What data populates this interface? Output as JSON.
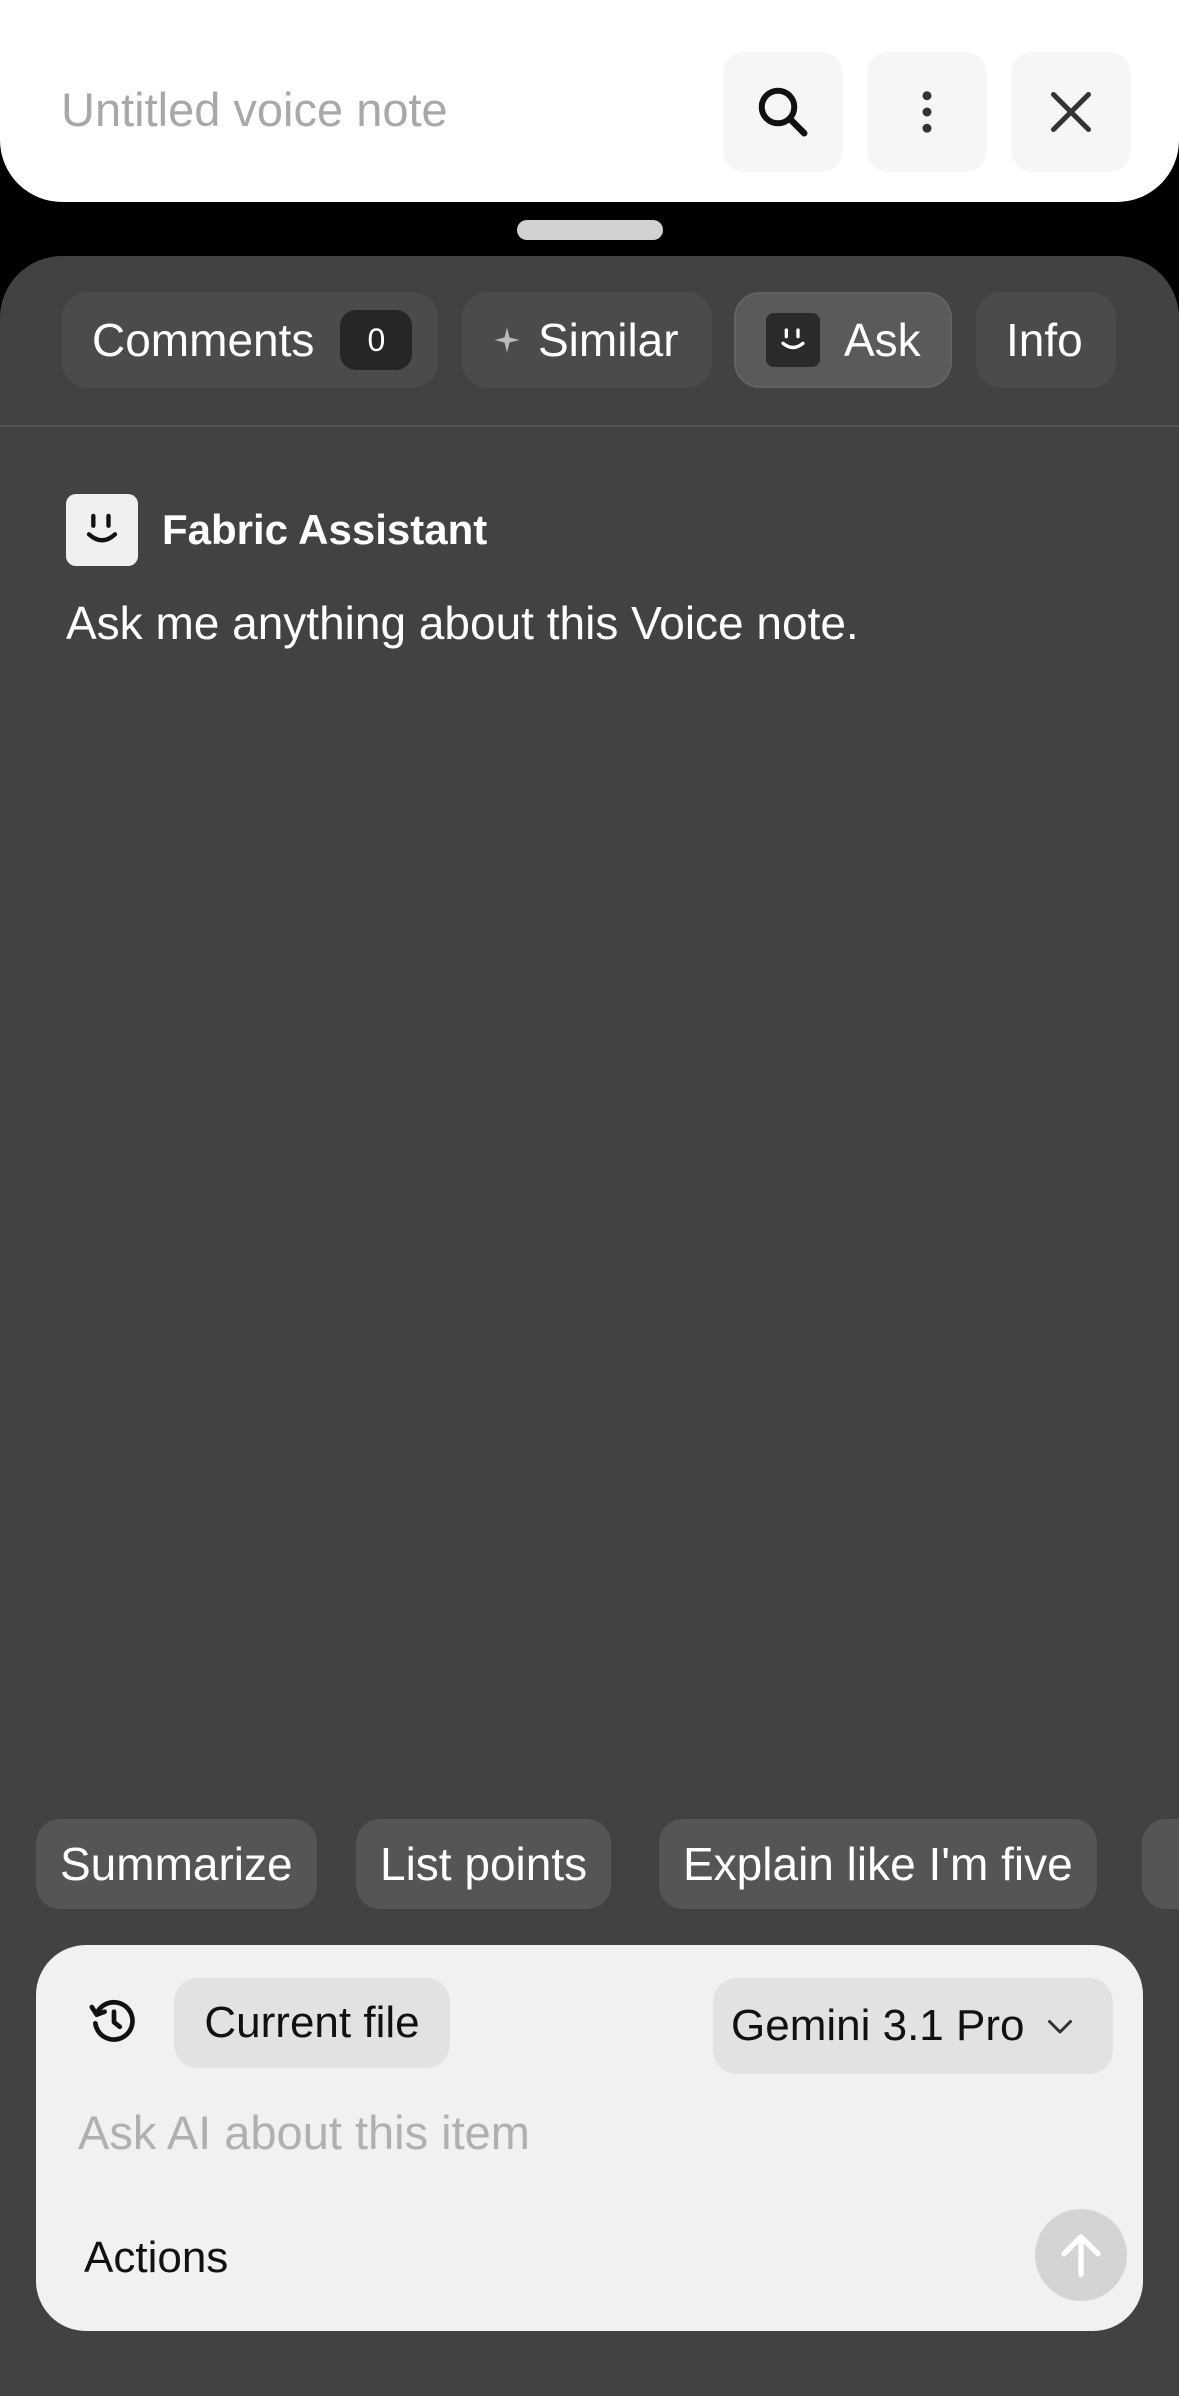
{
  "header": {
    "title": "Untitled voice note",
    "search_icon": "search-icon",
    "more_icon": "more-vertical-icon",
    "close_icon": "close-icon"
  },
  "tabs": [
    {
      "label": "Comments",
      "count": "0",
      "icon": null,
      "active": false
    },
    {
      "label": "Similar",
      "icon": "sparkle-icon",
      "active": false
    },
    {
      "label": "Ask",
      "icon": "assistant-face-icon",
      "active": true
    },
    {
      "label": "Info",
      "icon": null,
      "active": false
    }
  ],
  "assistant": {
    "name": "Fabric Assistant",
    "message": "Ask me anything about this Voice note.",
    "icon": "assistant-face-icon"
  },
  "suggestions": [
    "Summarize",
    "List points",
    "Explain like I'm five"
  ],
  "composer": {
    "history_icon": "history-icon",
    "scope": "Current file",
    "model": "Gemini 3.1 Pro",
    "placeholder": "Ask AI about this item",
    "actions_label": "Actions",
    "send_icon": "arrow-up-icon"
  },
  "colors": {
    "background": "#000000",
    "sheet": "#424242",
    "tab": "#4b4b4b",
    "tab_active": "#5a5a5a",
    "chip": "#555555",
    "composer": "#f1f1f1"
  }
}
